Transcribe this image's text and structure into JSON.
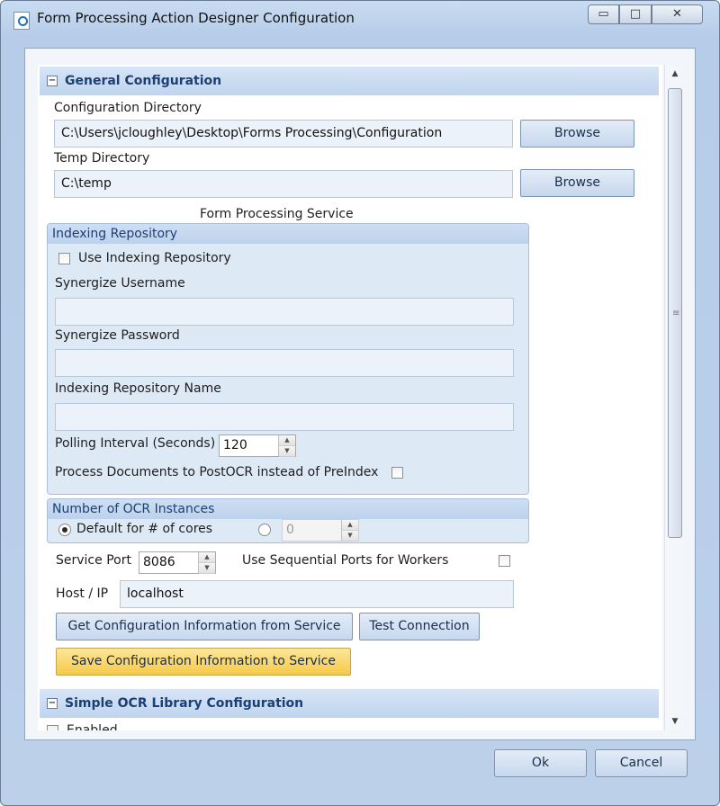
{
  "window": {
    "title": "Form Processing Action Designer Configuration",
    "controls": {
      "minimize": "▭",
      "maximize": "□",
      "close": "✕"
    }
  },
  "general": {
    "title": "General Configuration",
    "toggle": "−",
    "config_dir_label": "Configuration Directory",
    "config_dir_value": "C:\\Users\\jcloughley\\Desktop\\Forms Processing\\Configuration",
    "browse_label": "Browse",
    "temp_dir_label": "Temp Directory",
    "temp_dir_value": "C:\\temp",
    "service_heading": "Form Processing Service",
    "indexing": {
      "title": "Indexing Repository",
      "use_label": "Use Indexing Repository",
      "use_checked": false,
      "username_label": "Synergize Username",
      "username_value": "",
      "password_label": "Synergize Password",
      "password_value": "",
      "repo_name_label": "Indexing Repository Name",
      "repo_name_value": "",
      "polling_label": "Polling Interval (Seconds)",
      "polling_value": "120",
      "postocr_label": "Process Documents to PostOCR instead of PreIndex",
      "postocr_checked": false
    },
    "ocr": {
      "title": "Number of OCR Instances",
      "default_label": "Default for # of cores",
      "default_selected": true,
      "custom_value": "0"
    },
    "service_port_label": "Service Port",
    "service_port_value": "8086",
    "sequential_label": "Use Sequential Ports for Workers",
    "sequential_checked": false,
    "host_label": "Host / IP",
    "host_value": "localhost",
    "get_config_label": "Get Configuration Information from Service",
    "test_conn_label": "Test Connection",
    "save_config_label": "Save Configuration Information to Service"
  },
  "simple_ocr": {
    "title": "Simple OCR Library Configuration",
    "toggle": "−",
    "enabled_label": "Enabled"
  },
  "footer": {
    "ok_label": "Ok",
    "cancel_label": "Cancel"
  },
  "colors": {
    "accent": "#1c3f74",
    "save_button": "#f6c949",
    "section_header": "#bfd4ee"
  }
}
